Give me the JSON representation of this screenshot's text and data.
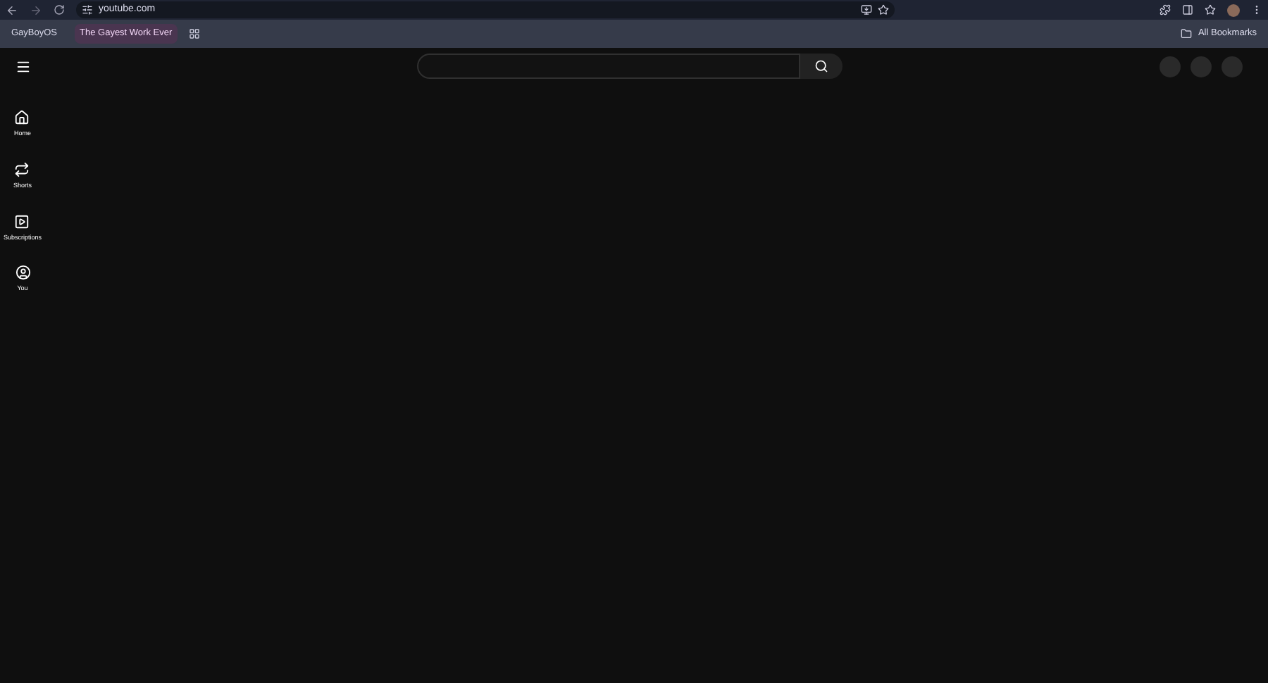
{
  "browser": {
    "url": "youtube.com",
    "bookmarks": [
      {
        "label": "GayBoyOS",
        "kind": "plain"
      },
      {
        "label": "The Gayest Work Ever",
        "kind": "group"
      }
    ],
    "all_bookmarks": "All Bookmarks"
  },
  "sidebar": {
    "items": [
      {
        "label": "Home",
        "kind": "home"
      },
      {
        "label": "Shorts",
        "kind": "shorts"
      },
      {
        "label": "Subscriptions",
        "kind": "subscriptions"
      },
      {
        "label": "You",
        "kind": "you"
      }
    ]
  }
}
